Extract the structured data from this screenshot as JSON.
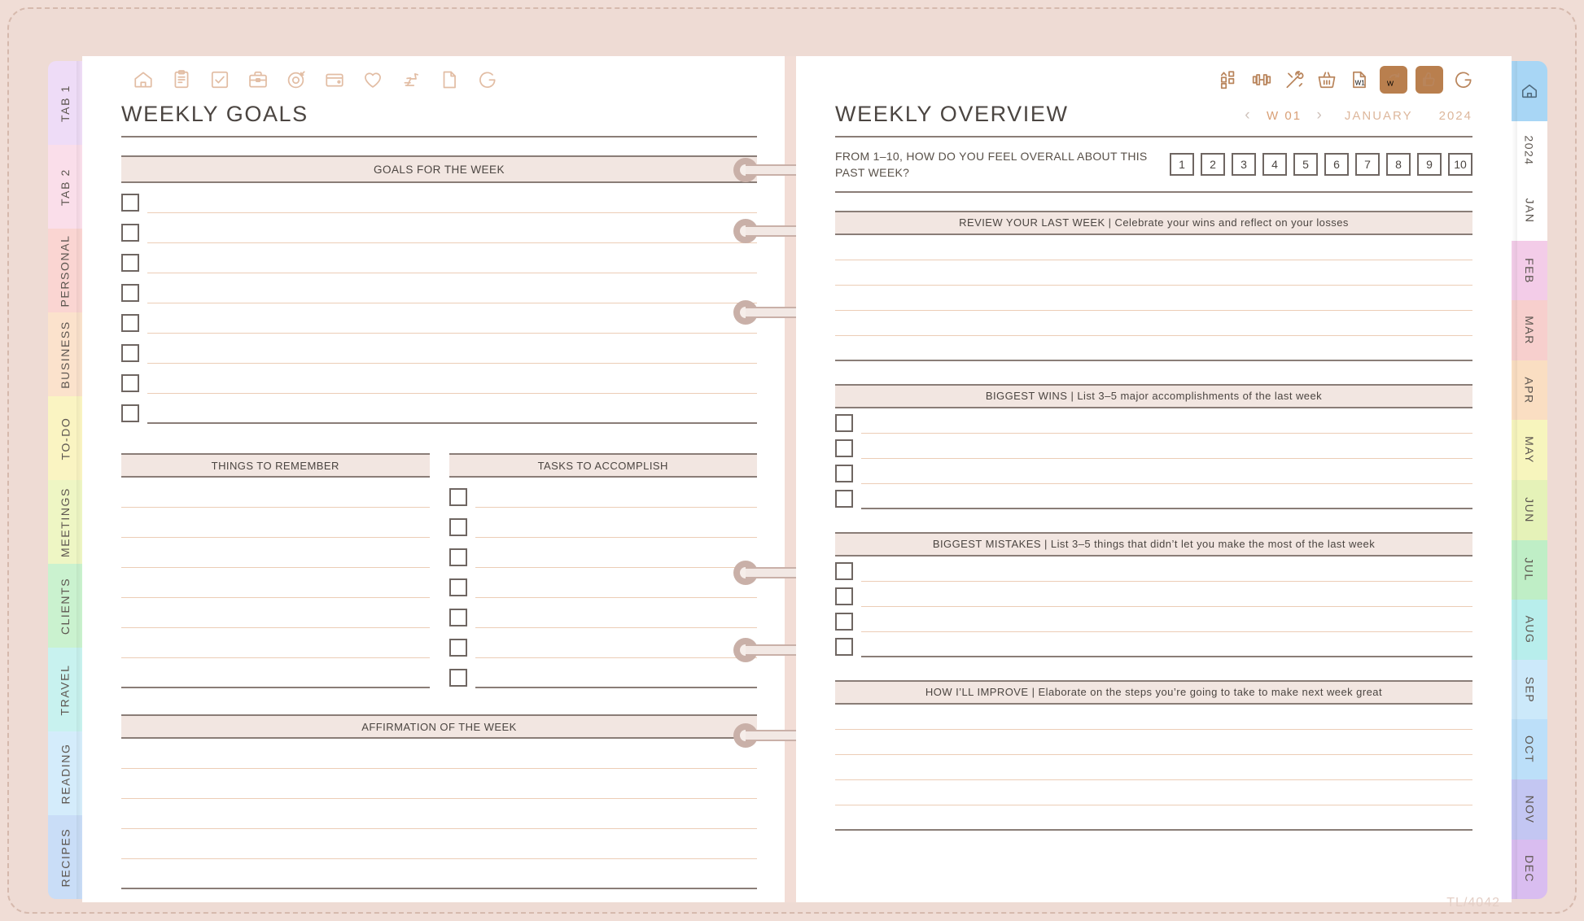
{
  "app": {
    "background_color": "#f0ddd6",
    "watermark": "TL/4042"
  },
  "toolbar_left": {
    "icons": [
      {
        "name": "home-icon",
        "glyph": "home"
      },
      {
        "name": "clipboard-icon",
        "glyph": "clipboard"
      },
      {
        "name": "checkbox-icon",
        "glyph": "check-square"
      },
      {
        "name": "briefcase-icon",
        "glyph": "briefcase"
      },
      {
        "name": "target-icon",
        "glyph": "target"
      },
      {
        "name": "wallet-icon",
        "glyph": "wallet"
      },
      {
        "name": "heart-icon",
        "glyph": "heart"
      },
      {
        "name": "exercise-bike-icon",
        "glyph": "bike"
      },
      {
        "name": "page-icon",
        "glyph": "page"
      },
      {
        "name": "g-logo-icon",
        "glyph": "g"
      }
    ]
  },
  "toolbar_right": {
    "active_color": "#b97f4e",
    "icons": [
      {
        "name": "layout-grid-icon",
        "glyph": "grid",
        "active": false
      },
      {
        "name": "dumbbell-icon",
        "glyph": "dumbbell",
        "active": false
      },
      {
        "name": "paint-tools-icon",
        "glyph": "tools",
        "active": false
      },
      {
        "name": "basket-icon",
        "glyph": "basket",
        "active": false
      },
      {
        "name": "weekly-page-icon",
        "glyph": "w-page",
        "active": false
      },
      {
        "name": "weekly-refresh-icon",
        "glyph": "w-refresh",
        "active": true
      },
      {
        "name": "weekly-thumbs-up-icon",
        "glyph": "w-thumb",
        "active": true
      },
      {
        "name": "g-logo-icon",
        "glyph": "g",
        "active": false
      }
    ]
  },
  "left_tabs": [
    {
      "label": "TAB 1",
      "color": "#eedcf7"
    },
    {
      "label": "TAB 2",
      "color": "#fadeea"
    },
    {
      "label": "PERSONAL",
      "color": "#fad5d2"
    },
    {
      "label": "BUSINESS",
      "color": "#fbe2cc"
    },
    {
      "label": "TO-DO",
      "color": "#faf4c2"
    },
    {
      "label": "MEETINGS",
      "color": "#eef6c4"
    },
    {
      "label": "CLIENTS",
      "color": "#caf2cf"
    },
    {
      "label": "TRAVEL",
      "color": "#c8f2ef"
    },
    {
      "label": "READING",
      "color": "#d4ecfb"
    },
    {
      "label": "RECIPES",
      "color": "#c9ddf7"
    }
  ],
  "right_tabs": [
    {
      "label": "",
      "icon": "home-icon",
      "color": "#a8d6f5"
    },
    {
      "label": "2024",
      "color": "#ffffff"
    },
    {
      "label": "JAN",
      "color": "#ffffff"
    },
    {
      "label": "FEB",
      "color": "#f3cce8"
    },
    {
      "label": "MAR",
      "color": "#f7cfcd"
    },
    {
      "label": "APR",
      "color": "#fade c2"
    },
    {
      "label": "MAY",
      "color": "#f7f5bd"
    },
    {
      "label": "JUN",
      "color": "#e5f2b8"
    },
    {
      "label": "JUL",
      "color": "#bfeec6"
    },
    {
      "label": "AUG",
      "color": "#b8eeec"
    },
    {
      "label": "SEP",
      "color": "#cce9fa"
    },
    {
      "label": "OCT",
      "color": "#bcdff9"
    },
    {
      "label": "NOV",
      "color": "#c3c6f2"
    },
    {
      "label": "DEC",
      "color": "#d9bdf0"
    }
  ],
  "left_page": {
    "title": "WEEKLY GOALS",
    "goals_band": "GOALS FOR THE WEEK",
    "goals_rows": 8,
    "things_to_remember": {
      "band": "THINGS TO REMEMBER",
      "rows": 7
    },
    "tasks_to_accomplish": {
      "band": "TASKS TO ACCOMPLISH",
      "rows": 7
    },
    "affirmation": {
      "band": "AFFIRMATION OF THE WEEK",
      "rows": 5
    }
  },
  "right_page": {
    "title": "WEEKLY OVERVIEW",
    "nav": {
      "prev": "‹",
      "week": "W 01",
      "next": "›",
      "month": "JANUARY",
      "year": "2024"
    },
    "rating": {
      "question": "FROM 1–10, HOW DO YOU FEEL OVERALL ABOUT THIS PAST WEEK?",
      "options": [
        "1",
        "2",
        "3",
        "4",
        "5",
        "6",
        "7",
        "8",
        "9",
        "10"
      ]
    },
    "sections": [
      {
        "band": "REVIEW YOUR LAST WEEK | Celebrate your wins and reflect on your losses",
        "type": "lines",
        "rows": 5
      },
      {
        "band": "BIGGEST WINS | List 3–5 major accomplishments of the last week",
        "type": "checklist",
        "rows": 4
      },
      {
        "band": "BIGGEST MISTAKES | List 3–5 things that didn’t let you make the most of the last week",
        "type": "checklist",
        "rows": 4
      },
      {
        "band": "HOW I’LL IMPROVE | Elaborate on the steps you’re going to take to make next week great",
        "type": "lines",
        "rows": 5
      }
    ]
  }
}
